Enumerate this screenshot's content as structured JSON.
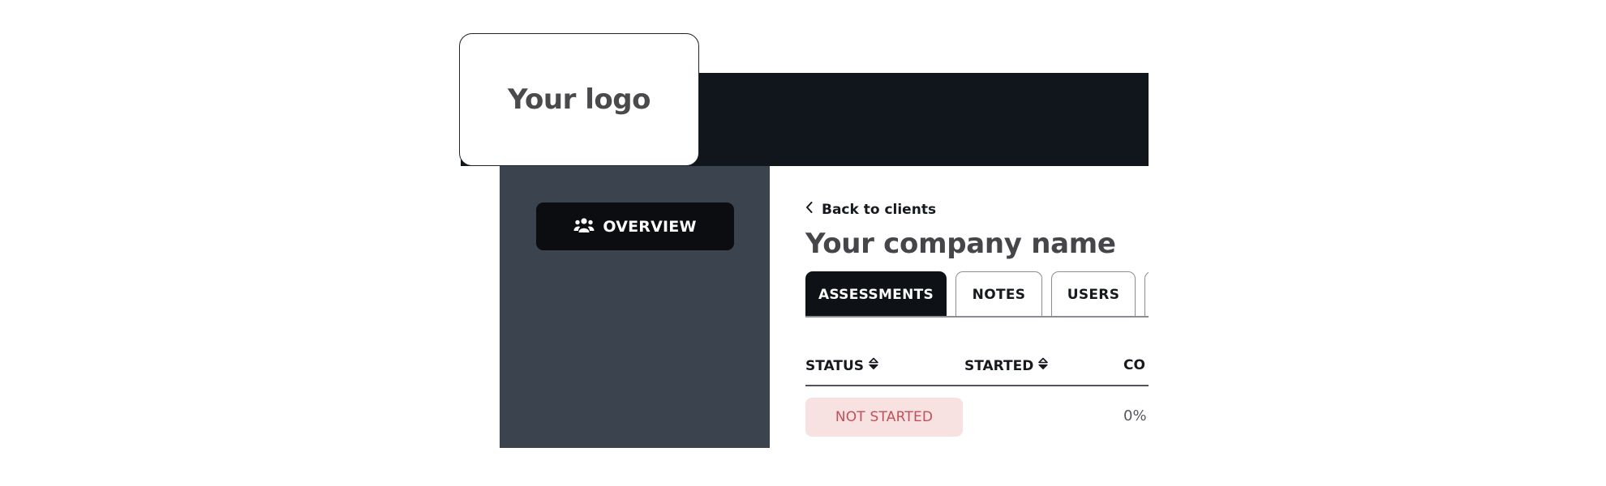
{
  "logo": {
    "text": "Your logo"
  },
  "sidebar": {
    "overview_label": "OVERVIEW",
    "overview_icon": "users-group-icon"
  },
  "main": {
    "back_link": "Back to clients",
    "back_icon": "chevron-left-icon",
    "page_title": "Your company name",
    "tabs": [
      {
        "label": "ASSESSMENTS",
        "active": true
      },
      {
        "label": "NOTES",
        "active": false
      },
      {
        "label": "USERS",
        "active": false
      },
      {
        "label": "",
        "active": false
      }
    ],
    "table": {
      "columns": [
        {
          "label": "STATUS",
          "sortable": true
        },
        {
          "label": "STARTED",
          "sortable": true
        },
        {
          "label": "CO",
          "sortable": false
        }
      ],
      "rows": [
        {
          "status": "NOT STARTED",
          "started": "",
          "completion": "0%"
        }
      ]
    }
  },
  "colors": {
    "topbar": "#11151c",
    "sidebar": "#3b434e",
    "active_tab": "#0e1116",
    "status_not_started_bg": "#f7e1e1",
    "status_not_started_text": "#c2505a"
  }
}
